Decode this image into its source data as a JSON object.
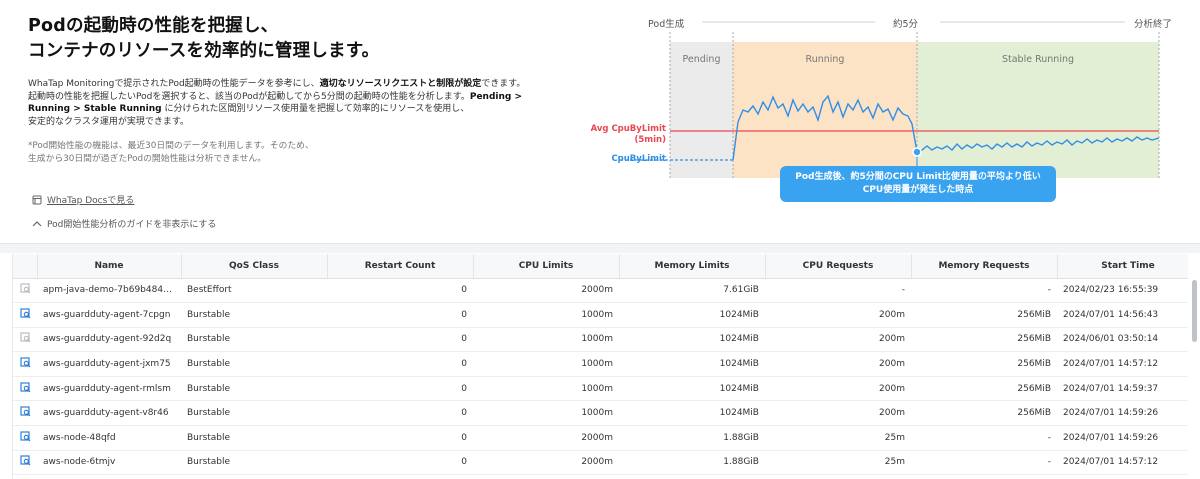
{
  "guide": {
    "title_line1": "Podの起動時の性能を把握し、",
    "title_line2": "コンテナのリソースを効率的に管理します。",
    "desc1_a": "WhaTap Monitoringで提示されたPod起動時の性能データを参考にし、",
    "desc1_b": "適切なリソースリクエストと制限が設定",
    "desc1_c": "できます。",
    "desc2_a": "起動時の性能を把握したいPodを選択すると、該当のPodが起動してから5分間の起動時の性能を分析します。",
    "desc2_b": "Pending >",
    "desc3_a": "Running > Stable Running",
    "desc3_b": " に分けられた区間別リソース使用量を把握して効率的にリソースを使用し、",
    "desc4": "安定的なクラスタ運用が実現できます。",
    "note1": "*Pod開始性能の機能は、最近30日間のデータを利用します。そのため、",
    "note2": "生成から30日間が過ぎたPodの開始性能は分析できません。",
    "docs_link": "WhaTap Docsで見る",
    "hide_toggle": "Pod開始性能分析のガイドを非表示にする"
  },
  "diagram": {
    "label_start": "Pod生成",
    "label_mid": "約5分",
    "label_end": "分析終了",
    "phase_pending": "Pending",
    "phase_running": "Running",
    "phase_stable": "Stable Running",
    "avg_label_1": "Avg CpuByLimit",
    "avg_label_2": "(5min)",
    "cpu_label": "CpuByLimit",
    "callout_1": "Pod生成後、約5分間のCPU Limit比使用量の平均より低い",
    "callout_2": "CPU使用量が発生した時点",
    "colors": {
      "avg_line": "#e8474f",
      "cpu_line": "#2f8fe6",
      "pending_bg": "#ebebeb",
      "running_bg": "#fde3c6",
      "stable_bg": "#e2efd4"
    }
  },
  "table": {
    "columns": [
      "Name",
      "QoS Class",
      "Restart Count",
      "CPU Limits",
      "Memory Limits",
      "CPU Requests",
      "Memory Requests",
      "Start Time"
    ],
    "rows": [
      {
        "icon": "analyze-icon-disabled",
        "name": "apm-java-demo-7b69b484cf-...",
        "qos": "BestEffort",
        "restart": "0",
        "cpu_limits": "2000m",
        "mem_limits": "7.61GiB",
        "cpu_requests": "-",
        "mem_requests": "-",
        "start": "2024/02/23 16:55:39"
      },
      {
        "icon": "analyze-icon",
        "name": "aws-guardduty-agent-7cpgn",
        "qos": "Burstable",
        "restart": "0",
        "cpu_limits": "1000m",
        "mem_limits": "1024MiB",
        "cpu_requests": "200m",
        "mem_requests": "256MiB",
        "start": "2024/07/01 14:56:43"
      },
      {
        "icon": "analyze-icon-disabled",
        "name": "aws-guardduty-agent-92d2q",
        "qos": "Burstable",
        "restart": "0",
        "cpu_limits": "1000m",
        "mem_limits": "1024MiB",
        "cpu_requests": "200m",
        "mem_requests": "256MiB",
        "start": "2024/06/01 03:50:14"
      },
      {
        "icon": "analyze-icon",
        "name": "aws-guardduty-agent-jxm75",
        "qos": "Burstable",
        "restart": "0",
        "cpu_limits": "1000m",
        "mem_limits": "1024MiB",
        "cpu_requests": "200m",
        "mem_requests": "256MiB",
        "start": "2024/07/01 14:57:12"
      },
      {
        "icon": "analyze-icon",
        "name": "aws-guardduty-agent-rmlsm",
        "qos": "Burstable",
        "restart": "0",
        "cpu_limits": "1000m",
        "mem_limits": "1024MiB",
        "cpu_requests": "200m",
        "mem_requests": "256MiB",
        "start": "2024/07/01 14:59:37"
      },
      {
        "icon": "analyze-icon",
        "name": "aws-guardduty-agent-v8r46",
        "qos": "Burstable",
        "restart": "0",
        "cpu_limits": "1000m",
        "mem_limits": "1024MiB",
        "cpu_requests": "200m",
        "mem_requests": "256MiB",
        "start": "2024/07/01 14:59:26"
      },
      {
        "icon": "analyze-icon",
        "name": "aws-node-48qfd",
        "qos": "Burstable",
        "restart": "0",
        "cpu_limits": "2000m",
        "mem_limits": "1.88GiB",
        "cpu_requests": "25m",
        "mem_requests": "-",
        "start": "2024/07/01 14:59:26"
      },
      {
        "icon": "analyze-icon",
        "name": "aws-node-6tmjv",
        "qos": "Burstable",
        "restart": "0",
        "cpu_limits": "2000m",
        "mem_limits": "1.88GiB",
        "cpu_requests": "25m",
        "mem_requests": "-",
        "start": "2024/07/01 14:57:12"
      }
    ]
  }
}
